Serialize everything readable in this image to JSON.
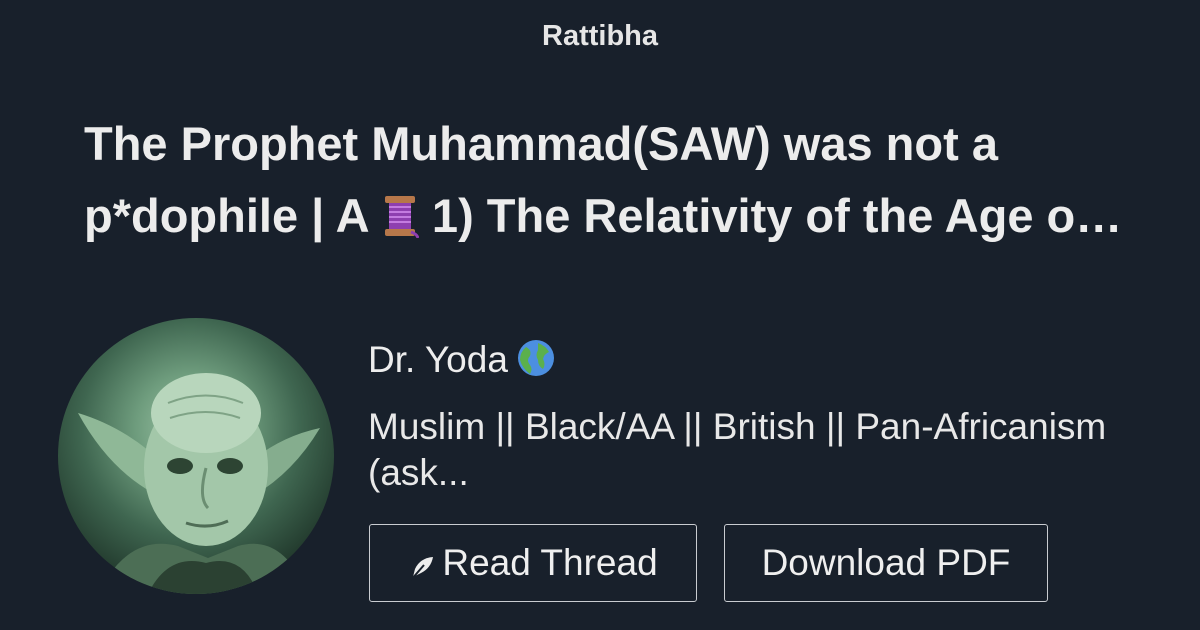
{
  "site": {
    "name": "Rattibha"
  },
  "thread": {
    "title_part1": "The Prophet Muhammad(SAW) was not a p*dophile | A ",
    "title_icon": "thread-spool-icon",
    "title_part2": " 1) The Relativity of the Age o…"
  },
  "author": {
    "name": "Dr. Yoda",
    "name_icon": "globe-icon",
    "bio": "Muslim || Black/AA || British || Pan-Africanism (ask...",
    "avatar": "yoda-avatar"
  },
  "actions": {
    "read_label": "Read Thread",
    "read_icon": "feather-icon",
    "pdf_label": "Download PDF"
  },
  "colors": {
    "background": "#18202b",
    "text": "#e8e8e8",
    "button_border": "#c9ccd1",
    "avatar_tint": "#6e9c7d"
  }
}
